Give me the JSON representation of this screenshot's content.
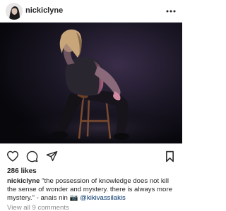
{
  "post": {
    "username": "nickiclyne",
    "likes_text": "286 likes",
    "caption": {
      "username": "nickiclyne",
      "text": "\"the possession of knowledge does not kill the sense of wonder and mystery. there is always more mystery.\" - anais nin ",
      "camera_emoji": "📷",
      "mention": "@kikivassilakis"
    },
    "view_comments": "View all 9 comments"
  },
  "icons": {
    "more": "more-options-icon",
    "like": "heart-icon",
    "comment": "comment-icon",
    "share": "paper-plane-icon",
    "save": "bookmark-icon"
  }
}
